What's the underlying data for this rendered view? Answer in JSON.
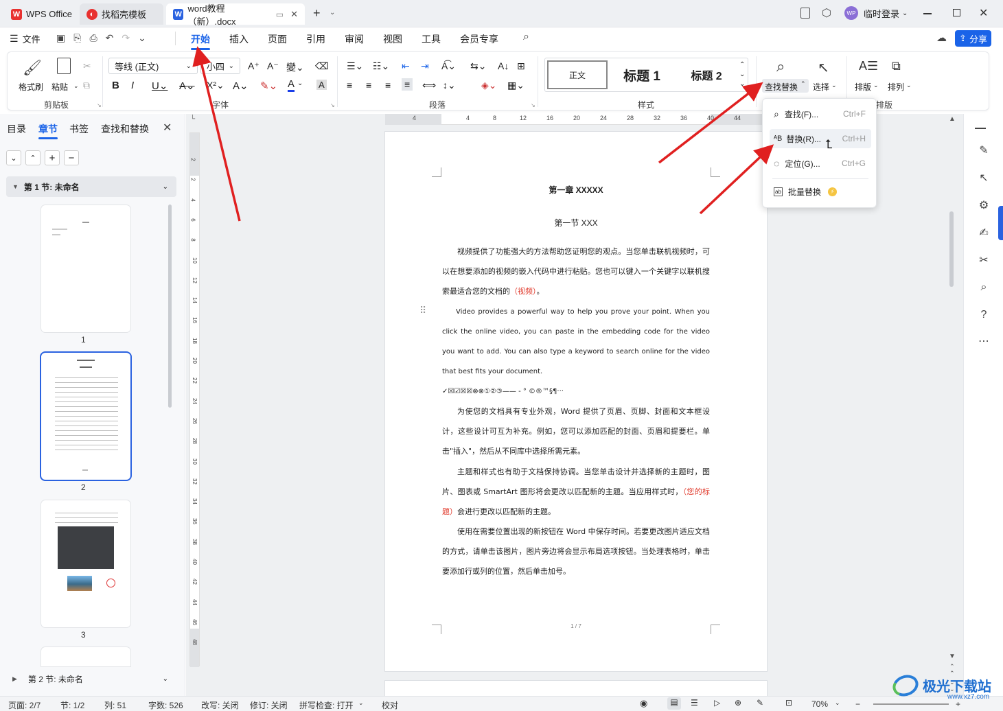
{
  "titlebar": {
    "tabs": [
      {
        "label": "WPS Office",
        "icon": "wps-logo-icon"
      },
      {
        "label": "找稻壳模板",
        "icon": "docer-icon"
      },
      {
        "label": "word教程（新）.docx",
        "icon": "word-doc-icon"
      }
    ],
    "login_label": "临时登录",
    "avatar_text": "WP"
  },
  "menubar": {
    "file": "文件",
    "items": [
      "开始",
      "插入",
      "页面",
      "引用",
      "审阅",
      "视图",
      "工具",
      "会员专享"
    ],
    "active": "开始",
    "share": "分享"
  },
  "ribbon": {
    "clipboard": {
      "format_painter": "格式刷",
      "paste": "粘贴",
      "group": "剪贴板"
    },
    "font": {
      "family": "等线 (正文)",
      "size": "小四",
      "group": "字体"
    },
    "paragraph": {
      "group": "段落"
    },
    "styles": {
      "normal": "正文",
      "h1": "标题 1",
      "h2": "标题 2",
      "group": "样式"
    },
    "find": {
      "find_replace": "查找替换",
      "select": "选择"
    },
    "layout": {
      "arrange": "排版",
      "order": "排列",
      "group": "排版"
    }
  },
  "dropdown": {
    "items": [
      {
        "label": "查找(F)...",
        "shortcut": "Ctrl+F",
        "icon": "search-icon"
      },
      {
        "label": "替换(R)...",
        "shortcut": "Ctrl+H",
        "icon": "replace-icon"
      },
      {
        "label": "定位(G)...",
        "shortcut": "Ctrl+G",
        "icon": "locate-icon"
      },
      {
        "label": "批量替换",
        "shortcut": "",
        "icon": "batch-replace-icon"
      }
    ]
  },
  "sidepanel": {
    "tabs": [
      "目录",
      "章节",
      "书签",
      "查找和替换"
    ],
    "active_tab": "章节",
    "section1": "第 1 节: 未命名",
    "section2": "第 2 节: 未命名",
    "pages": [
      "1",
      "2",
      "3"
    ]
  },
  "ruler": {
    "h_ticks": [
      "4",
      "4",
      "8",
      "12",
      "16",
      "20",
      "24",
      "28",
      "32",
      "36",
      "40",
      "44"
    ],
    "v_ticks": [
      "2",
      "2",
      "4",
      "6",
      "8",
      "10",
      "12",
      "14",
      "16",
      "18",
      "20",
      "22",
      "24",
      "26",
      "28",
      "30",
      "32",
      "34",
      "36",
      "38",
      "40",
      "42",
      "44",
      "46",
      "48"
    ]
  },
  "document": {
    "chapter": "第一章  XXXXX",
    "section": "第一节  XXX",
    "p1": "视频提供了功能强大的方法帮助您证明您的观点。当您单击联机视频时，可以在想要添加的视频的嵌入代码中进行粘贴。您也可以键入一个关键字以联机搜索最适合您的文档的",
    "p1_red": "（视频）",
    "p1_end": "。",
    "p2": "Video provides a powerful way to help you prove your point. When you click the online video, you can paste in the embedding code for the video you want to add. You can also type a keyword to search online for the video that best fits your document.",
    "symbols": "✓☒☑☒☒⊗⊗①②③——  -   °  ©®™§¶···",
    "p3": "为使您的文档具有专业外观，Word 提供了页眉、页脚、封面和文本框设计，这些设计可互为补充。例如，您可以添加匹配的封面、页眉和提要栏。单击\"插入\"，然后从不同库中选择所需元素。",
    "p4_a": "主题和样式也有助于文档保持协调。当您单击设计并选择新的主题时，图片、图表或 SmartArt 图形将会更改以匹配新的主题。当应用样式时，",
    "p4_red": "（您的标题）",
    "p4_b": "会进行更改以匹配新的主题。",
    "p5": "使用在需要位置出现的新按钮在 Word 中保存时间。若要更改图片适应文档的方式，请单击该图片，图片旁边将会显示布局选项按钮。当处理表格时，单击要添加行或列的位置，然后单击加号。",
    "page_footer": "1 / 7"
  },
  "statusbar": {
    "page": "页面: 2/7",
    "section": "节: 1/2",
    "col": "列: 51",
    "words": "字数: 526",
    "rewrite": "改写: 关闭",
    "revision": "修订: 关闭",
    "spell": "拼写检查: 打开",
    "proof": "校对",
    "zoom": "70%"
  },
  "watermark": {
    "text": "极光下载站",
    "url": "www.xz7.com"
  },
  "colors": {
    "accent": "#1a63e8",
    "arrow": "#e02020",
    "red_text": "#e0392b"
  }
}
